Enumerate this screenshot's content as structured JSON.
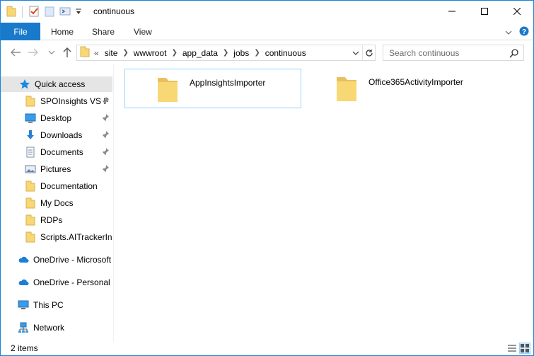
{
  "window": {
    "title": "continuous"
  },
  "ribbon": {
    "tabs": [
      "File",
      "Home",
      "Share",
      "View"
    ]
  },
  "address": {
    "overflow": "«",
    "crumbs": [
      "site",
      "wwwroot",
      "app_data",
      "jobs",
      "continuous"
    ]
  },
  "search": {
    "placeholder": "Search continuous"
  },
  "sidebar": {
    "items": [
      {
        "label": "Quick access",
        "icon": "star-icon"
      },
      {
        "label": "SPOInsights VS F",
        "icon": "folder-icon",
        "pinned": true
      },
      {
        "label": "Desktop",
        "icon": "desktop-icon",
        "pinned": true
      },
      {
        "label": "Downloads",
        "icon": "download-icon",
        "pinned": true
      },
      {
        "label": "Documents",
        "icon": "documents-icon",
        "pinned": true
      },
      {
        "label": "Pictures",
        "icon": "pictures-icon",
        "pinned": true
      },
      {
        "label": "Documentation",
        "icon": "folder-icon"
      },
      {
        "label": "My Docs",
        "icon": "folder-icon"
      },
      {
        "label": "RDPs",
        "icon": "folder-icon"
      },
      {
        "label": "Scripts.AITrackerIns",
        "icon": "folder-icon"
      },
      {
        "label": "OneDrive - Microsoft",
        "icon": "onedrive-icon"
      },
      {
        "label": "OneDrive - Personal",
        "icon": "onedrive-icon"
      },
      {
        "label": "This PC",
        "icon": "computer-icon"
      },
      {
        "label": "Network",
        "icon": "network-icon"
      }
    ]
  },
  "files": [
    {
      "name": "AppInsightsImporter",
      "icon": "folder-icon",
      "selected": true
    },
    {
      "name": "Office365ActivityImporter",
      "icon": "folder-icon",
      "selected": false
    }
  ],
  "status": {
    "count": "2 items"
  },
  "colors": {
    "accent": "#1979ca",
    "folder": "#f8d775",
    "selection": "#cce8ff"
  }
}
